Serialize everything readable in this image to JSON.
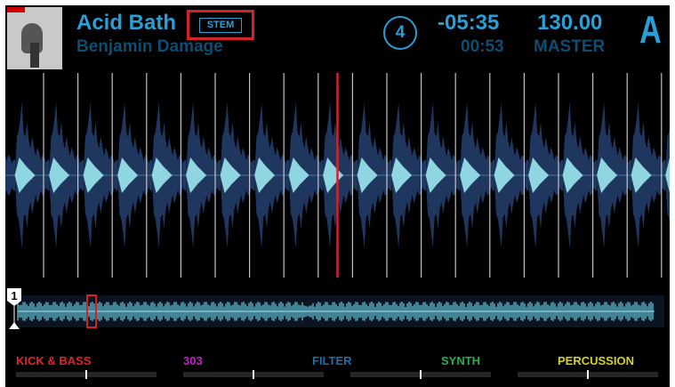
{
  "deck": {
    "title": "Acid Bath",
    "artist": "Benjamin Damage",
    "badge": "STEM",
    "beats_counter": "4",
    "time_remaining": "-05:35",
    "time_elapsed": "00:53",
    "bpm": "130.00",
    "sync_mode": "MASTER",
    "deck_letter": "A",
    "cue_marker": "1",
    "playhead_position": 0.5,
    "overview_position": 0.13
  },
  "stems": [
    {
      "label": "KICK & BASS",
      "color": "#e0252b"
    },
    {
      "label": "303",
      "color": "#c020c8"
    },
    {
      "label": "FILTER",
      "color": "#1f6fa8"
    },
    {
      "label": "SYNTH",
      "color": "#22b14c"
    },
    {
      "label": "PERCUSSION",
      "color": "#d7d21e"
    }
  ],
  "colors": {
    "accent": "#2a9fd6",
    "accent_dim": "#0e4d70",
    "waveform_outer": "#243f6e",
    "waveform_inner": "#8fd6e0",
    "playhead": "#d3222a",
    "highlight_box": "#d3222a"
  }
}
